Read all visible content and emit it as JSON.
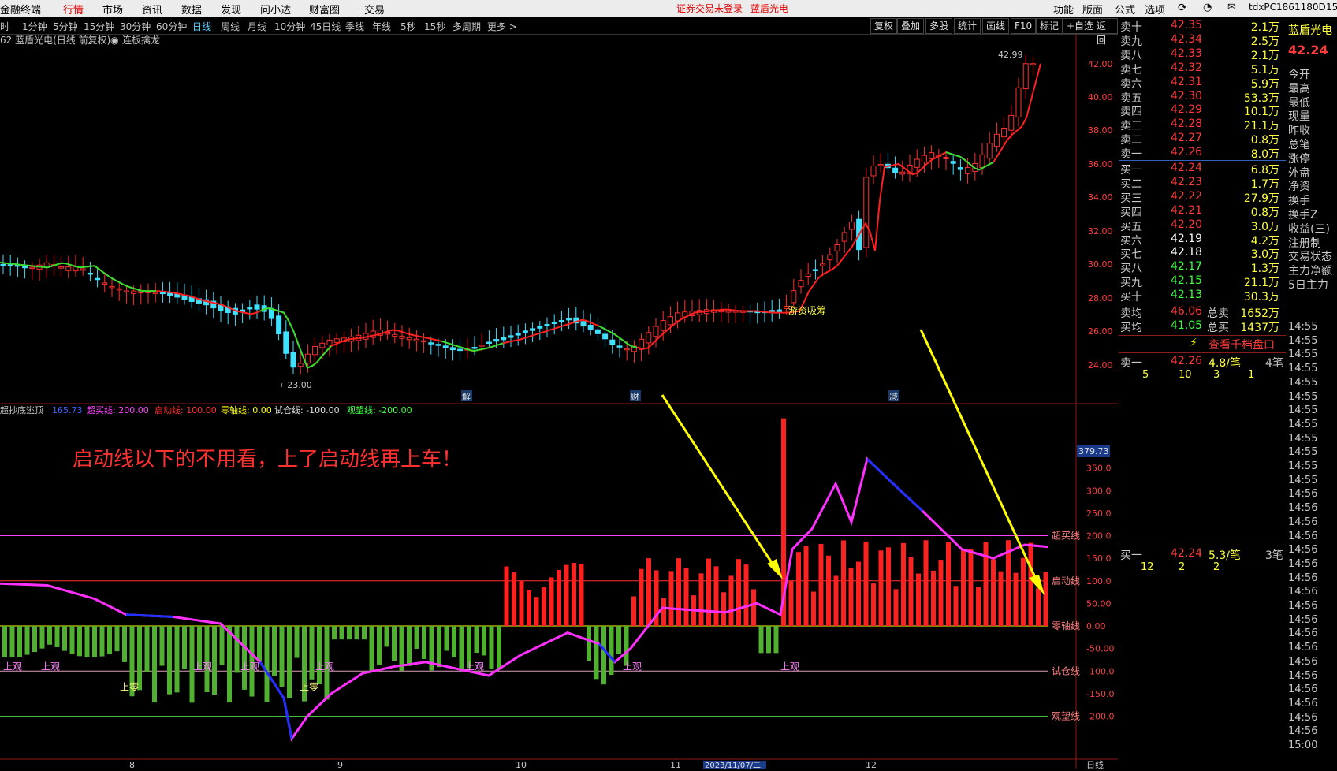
{
  "menubar": {
    "app_title": "金融终端",
    "tabs": [
      "行情",
      "市场",
      "资讯",
      "数据",
      "发现",
      "问小达",
      "财富圈",
      "交易"
    ],
    "active_tab": "行情",
    "notice": "证券交易未登录",
    "stock_name": "蓝盾光电",
    "right_items": [
      "功能",
      "版面",
      "公式",
      "选项"
    ],
    "user": "tdxPC1861180D",
    "extra": "15"
  },
  "periods": [
    "时",
    "1分钟",
    "5分钟",
    "15分钟",
    "30分钟",
    "60分钟",
    "日线",
    "周线",
    "月线",
    "10分钟",
    "45日线",
    "季线",
    "年线",
    "5秒",
    "15秒",
    "多周期",
    "更多 >"
  ],
  "active_period": "日线",
  "toolbar": [
    "复权",
    "叠加",
    "多股",
    "统计",
    "画线",
    "F10",
    "标记",
    "+自选",
    "返回"
  ],
  "chart_header": {
    "code_name": "62 蓝盾光电(日线 前复权)",
    "indicator": "连板擒龙"
  },
  "main_chart": {
    "high_label": "42.99",
    "low_label": "23.00",
    "annotation": "游资吸筹",
    "y_ticks": [
      "42.00",
      "40.00",
      "38.00",
      "36.00",
      "34.00",
      "32.00",
      "30.00",
      "28.00",
      "26.00",
      "24.00"
    ],
    "markers": [
      "解",
      "财",
      "减"
    ]
  },
  "sub_header": {
    "name": "超抄底逃顶",
    "value": "165.73",
    "items": [
      {
        "label": "超买线: 200.00",
        "color": "#ff40ff"
      },
      {
        "label": "启动线: 100.00",
        "color": "#ff3030"
      },
      {
        "label": "零轴线: 0.00",
        "color": "#ffff00"
      },
      {
        "label": "试仓线: -100.00",
        "color": "#e0e0e0"
      },
      {
        "label": "观望线: -200.00",
        "color": "#40ff40"
      }
    ]
  },
  "sub_chart": {
    "overlay_text": "启动线以下的不用看，上了启动线再上车！",
    "current_value": "379.73",
    "y_ticks": [
      "350.0",
      "300.0",
      "250.0",
      "200.0",
      "150.0",
      "100.0",
      "50.00",
      "0.00",
      "-50.00",
      "-100.0",
      "-150.0",
      "-200.0"
    ],
    "line_labels": [
      "超买线",
      "启动线",
      "零轴线",
      "试仓线",
      "观望线"
    ],
    "signal_labels": [
      "上观",
      "上观",
      "上零",
      "上观",
      "上观",
      "上零",
      "上观",
      "上观",
      "上观",
      "上观"
    ]
  },
  "x_axis": [
    "8",
    "9",
    "10",
    "11",
    "2023/11/07/二",
    "12"
  ],
  "x_axis_right": "日线",
  "quote": {
    "title": "蓝盾光电",
    "price": "42.24",
    "asks": [
      {
        "label": "卖十",
        "price": "42.35",
        "vol": "2.1万"
      },
      {
        "label": "卖九",
        "price": "42.34",
        "vol": "2.5万"
      },
      {
        "label": "卖八",
        "price": "42.33",
        "vol": "2.1万"
      },
      {
        "label": "卖七",
        "price": "42.32",
        "vol": "5.1万"
      },
      {
        "label": "卖六",
        "price": "42.31",
        "vol": "5.9万"
      },
      {
        "label": "卖五",
        "price": "42.30",
        "vol": "53.3万"
      },
      {
        "label": "卖四",
        "price": "42.29",
        "vol": "10.1万"
      },
      {
        "label": "卖三",
        "price": "42.28",
        "vol": "21.1万"
      },
      {
        "label": "卖二",
        "price": "42.27",
        "vol": "0.8万"
      },
      {
        "label": "卖一",
        "price": "42.26",
        "vol": "8.0万"
      }
    ],
    "bids": [
      {
        "label": "买一",
        "price": "42.24",
        "vol": "6.8万"
      },
      {
        "label": "买二",
        "price": "42.23",
        "vol": "1.7万"
      },
      {
        "label": "买三",
        "price": "42.22",
        "vol": "27.9万"
      },
      {
        "label": "买四",
        "price": "42.21",
        "vol": "0.8万"
      },
      {
        "label": "买五",
        "price": "42.20",
        "vol": "3.0万"
      },
      {
        "label": "买六",
        "price": "42.19",
        "vol": "4.2万"
      },
      {
        "label": "买七",
        "price": "42.18",
        "vol": "3.0万"
      },
      {
        "label": "买八",
        "price": "42.17",
        "vol": "1.3万"
      },
      {
        "label": "买九",
        "price": "42.15",
        "vol": "21.1万"
      },
      {
        "label": "买十",
        "price": "42.13",
        "vol": "30.3万"
      }
    ],
    "avg_sell": {
      "label": "卖均",
      "price": "46.06",
      "total_label": "总卖",
      "total": "1652万"
    },
    "avg_buy": {
      "label": "买均",
      "price": "41.05",
      "total_label": "总买",
      "total": "1437万"
    },
    "view_queue": "查看千档盘口",
    "sell1_queue": {
      "label": "卖一",
      "price": "42.26",
      "per": "4.8/笔",
      "count": "4笔",
      "orders": [
        "5",
        "10",
        "3",
        "1"
      ]
    },
    "buy1_queue": {
      "label": "买一",
      "price": "42.24",
      "per": "5.3/笔",
      "count": "3笔",
      "orders": [
        "12",
        "2",
        "2"
      ]
    }
  },
  "far_right": {
    "title": "蓝盾光电",
    "price": "42.24",
    "labels": [
      "今开",
      "最高",
      "最低",
      "现量",
      "昨收",
      "总笔",
      "涨停",
      "外盘",
      "净资",
      "换手",
      "换手Z",
      "收益(三)",
      "注册制",
      "交易状态",
      "主力净额",
      "5日主力"
    ],
    "times": [
      "14:55",
      "14:55",
      "14:55",
      "14:55",
      "14:55",
      "14:55",
      "14:55",
      "14:55",
      "14:55",
      "14:55",
      "14:55",
      "14:55",
      "14:56",
      "14:56",
      "14:56",
      "14:56",
      "14:56",
      "14:56",
      "14:56",
      "14:56",
      "14:56",
      "14:56",
      "14:56",
      "14:56",
      "14:56",
      "14:56",
      "14:56",
      "14:56",
      "14:56",
      "14:56",
      "15:00"
    ]
  },
  "colors": {
    "up": "#ff2a2a",
    "down": "#40e0ff",
    "ma_red": "#ff2020",
    "ma_green": "#30e030",
    "magenta": "#ff30ff",
    "blue": "#2030ff",
    "yellow": "#ffff00",
    "green_bar": "#50b030"
  }
}
